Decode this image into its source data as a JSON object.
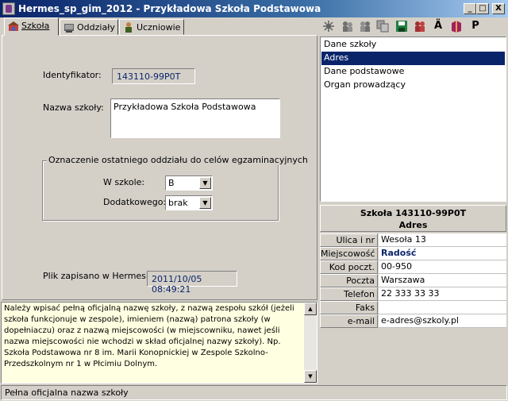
{
  "window": {
    "title": "Hermes_sp_gim_2012 - Przykładowa Szkoła Podstawowa",
    "buttons": {
      "minimize": "_",
      "maximize": "□",
      "close": "X"
    }
  },
  "tabs": [
    {
      "label": "Szkoła",
      "icon": "school-icon",
      "active": true
    },
    {
      "label": "Oddziały",
      "icon": "classes-icon",
      "active": false
    },
    {
      "label": "Uczniowie",
      "icon": "students-icon",
      "active": false
    }
  ],
  "form": {
    "identifier_label": "Identyfikator:",
    "identifier_value": "143110-99P0T",
    "name_label": "Nazwa szkoły:",
    "name_value": "Przykładowa Szkoła Podstawowa",
    "group_title": "Oznaczenie ostatniego oddziału do celów egzaminacyjnych",
    "in_school_label": "W szkole:",
    "in_school_value": "B",
    "additional_label": "Dodatkowego:",
    "additional_value": "brak",
    "saved_label": "Plik zapisano w Hermesie:",
    "saved_value": "2011/10/05 08:49:21"
  },
  "help": {
    "text": "Należy wpisać pełną oficjalną nazwę szkoły, z nazwą zespołu szkół (jeżeli szkoła funkcjonuje w zespole), imieniem (nazwą) patrona szkoły (w dopełniaczu) oraz z nazwą miejscowości (w miejscowniku, nawet jeśli nazwa miejscowości nie wchodzi w skład oficjalnej nazwy szkoły). Np. Szkoła Podstawowa nr 8 im. Marii Konopnickiej w Zespole Szkolno-Przedszkolnym nr 1 w Płcimiu Dolnym."
  },
  "status": {
    "text": "Pełna oficjalna nazwa szkoły"
  },
  "toolbar": {
    "icons": [
      "network-icon",
      "users-icon",
      "users-group-icon",
      "copy-icon",
      "save-icon",
      "people-icon",
      "a-umlaut-icon",
      "book-icon",
      "p-icon"
    ],
    "a_glyph": "Ä",
    "p_glyph": "P"
  },
  "list": {
    "items": [
      "Dane szkoły",
      "Adres",
      "Dane podstawowe",
      "Organ prowadzący"
    ],
    "selected_index": 1
  },
  "info": {
    "header_line1": "Szkoła 143110-99P0T",
    "header_line2": "Adres",
    "fields": [
      {
        "label": "Ulica i nr",
        "value": "Wesoła 13"
      },
      {
        "label": "Miejscowość",
        "value": "Radość"
      },
      {
        "label": "Kod poczt.",
        "value": "00-950"
      },
      {
        "label": "Poczta",
        "value": "Warszawa"
      },
      {
        "label": "Telefon",
        "value": "22 333 33 33"
      },
      {
        "label": "Faks",
        "value": ""
      },
      {
        "label": "e-mail",
        "value": "e-adres@szkoly.pl"
      }
    ]
  },
  "colors": {
    "title_gradient_start": "#0a246a",
    "selection": "#0a246a",
    "help_background": "#ffffe1",
    "window_background": "#d4d0c8"
  }
}
